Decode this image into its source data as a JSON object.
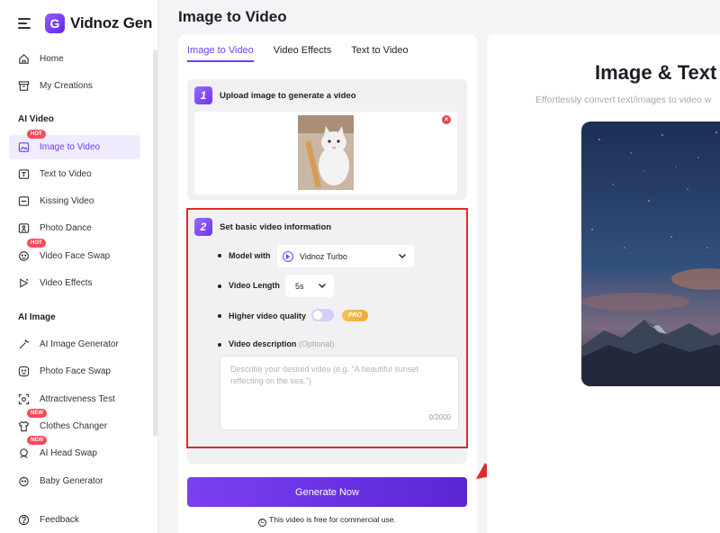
{
  "brand": {
    "name": "Vidnoz Gen",
    "logo_letter": "G"
  },
  "sidebar": {
    "items_top": [
      {
        "label": "Home",
        "icon": "home-icon"
      },
      {
        "label": "My Creations",
        "icon": "archive-icon"
      }
    ],
    "section_ai_video": "AI Video",
    "ai_video_items": [
      {
        "label": "Image to Video",
        "icon": "image-video-icon",
        "badge": "HOT",
        "active": true
      },
      {
        "label": "Text to Video",
        "icon": "text-video-icon"
      },
      {
        "label": "Kissing Video",
        "icon": "kiss-icon"
      },
      {
        "label": "Photo Dance",
        "icon": "dance-icon"
      },
      {
        "label": "Video Face Swap",
        "icon": "face-swap-icon",
        "badge": "HOT"
      },
      {
        "label": "Video Effects",
        "icon": "effects-icon"
      }
    ],
    "section_ai_image": "AI Image",
    "ai_image_items": [
      {
        "label": "AI Image Generator",
        "icon": "sparkle-icon"
      },
      {
        "label": "Photo Face Swap",
        "icon": "face-icon"
      },
      {
        "label": "Attractiveness Test",
        "icon": "scan-icon"
      },
      {
        "label": "Clothes Changer",
        "icon": "shirt-icon",
        "badge": "NEW"
      },
      {
        "label": "AI Head Swap",
        "icon": "head-icon",
        "badge": "NEW"
      },
      {
        "label": "Baby Generator",
        "icon": "baby-icon"
      }
    ],
    "feedback": "Feedback"
  },
  "main": {
    "title": "Image to Video",
    "tabs": [
      {
        "label": "Image to Video",
        "active": true
      },
      {
        "label": "Video Effects"
      },
      {
        "label": "Text to Video"
      }
    ],
    "step1": {
      "number": "1",
      "title": "Upload image to generate a video"
    },
    "step2": {
      "number": "2",
      "title": "Set basic video information",
      "model_label": "Model with",
      "model_value": "Vidnoz Turbo",
      "length_label": "Video Length",
      "length_value": "5s",
      "quality_label": "Higher video quality",
      "pro_badge": "PRO",
      "quality_enabled": false,
      "description_label": "Video description",
      "description_optional": "(Optional)",
      "description_placeholder": "Describe your desired video (e.g. \"A beautiful sunset reflecting on the sea.\")",
      "description_counter": "0/2000"
    },
    "generate_button": "Generate Now",
    "free_note": "This video is free for commercial use."
  },
  "right_panel": {
    "title": "Image & Text t",
    "subtitle": "Effortlessly convert text/images to video w"
  },
  "colors": {
    "accent": "#6b3ef5",
    "highlight_border": "#e02a2a",
    "hot_badge": "#f44b5a"
  }
}
